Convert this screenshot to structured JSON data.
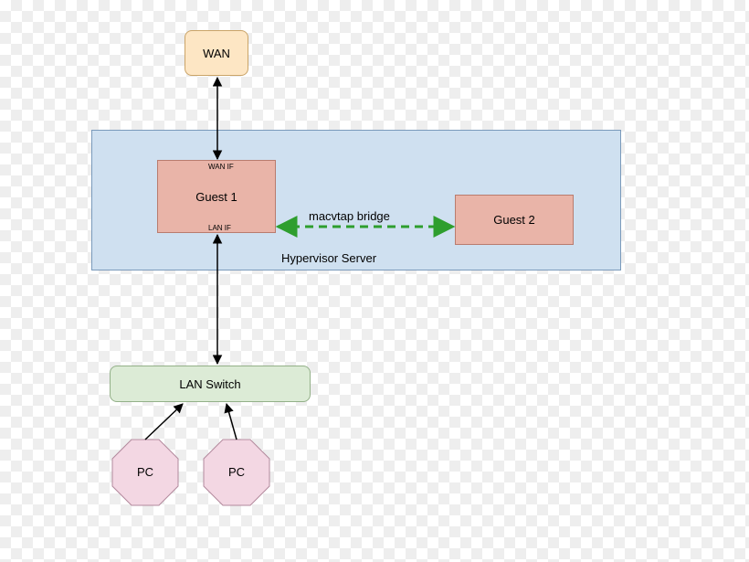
{
  "wan": {
    "label": "WAN"
  },
  "hypervisor": {
    "label": "Hypervisor Server"
  },
  "guest1": {
    "label": "Guest 1",
    "wan_if": "WAN IF",
    "lan_if": "LAN IF"
  },
  "guest2": {
    "label": "Guest 2"
  },
  "bridge": {
    "label": "macvtap bridge"
  },
  "lan_switch": {
    "label": "LAN Switch"
  },
  "pc1": {
    "label": "PC"
  },
  "pc2": {
    "label": "PC"
  }
}
